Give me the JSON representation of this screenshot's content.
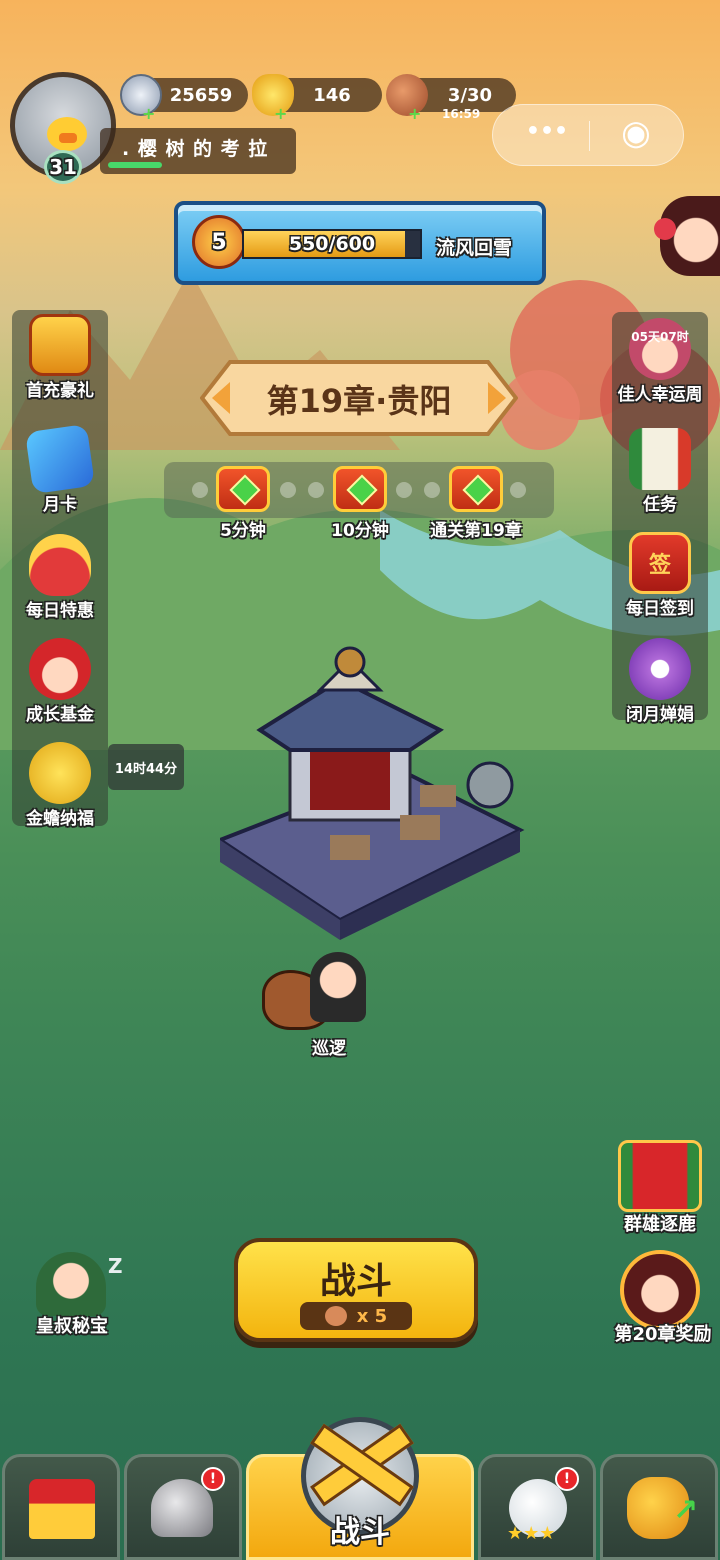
{
  "player": {
    "name": ". 樱 树 的 考 拉",
    "level": "31"
  },
  "resources": {
    "silver": "25659",
    "gold": "146",
    "stamina": "3/30",
    "stamina_timer": "16:59"
  },
  "capsule": {
    "more": "•••",
    "target": "◉"
  },
  "progress": {
    "level": "5",
    "value": "550/600",
    "fraction": 0.9167,
    "title": "流风回雪"
  },
  "chapter": {
    "title": "第19章·贵阳"
  },
  "chests": [
    {
      "label": "5分钟"
    },
    {
      "label": "10分钟"
    },
    {
      "label": "通关第19章"
    }
  ],
  "left_menu": [
    {
      "label": "首充豪礼",
      "icon": "gift-chest-icon"
    },
    {
      "label": "月卡",
      "icon": "month-card-icon"
    },
    {
      "label": "每日特惠",
      "icon": "gold-bag-icon"
    },
    {
      "label": "成长基金",
      "icon": "fortune-god-icon"
    },
    {
      "label": "金蟾纳福",
      "icon": "gold-toad-icon",
      "timer": "14时44分"
    }
  ],
  "right_menu": [
    {
      "label": "佳人幸运周",
      "icon": "beauty-icon",
      "timer": "05天07时"
    },
    {
      "label": "任务",
      "icon": "scroll-icon"
    },
    {
      "label": "每日签到",
      "icon": "sign-in-icon",
      "stamp": "签"
    },
    {
      "label": "闭月婵娟",
      "icon": "moon-flower-icon"
    }
  ],
  "patrol": {
    "label": "巡逻"
  },
  "bottom_left": {
    "label": "皇叔秘宝",
    "zz": "Z"
  },
  "bottom_right": [
    {
      "label": "群雄逐鹿"
    },
    {
      "label": "第20章奖励"
    }
  ],
  "battle": {
    "label": "战斗",
    "cost": "x 5"
  },
  "tabs": [
    {
      "icon": "castle-icon"
    },
    {
      "icon": "helmet-icon"
    },
    {
      "label": "战斗"
    },
    {
      "icon": "rooster-icon"
    },
    {
      "icon": "fist-upgrade-icon"
    }
  ]
}
